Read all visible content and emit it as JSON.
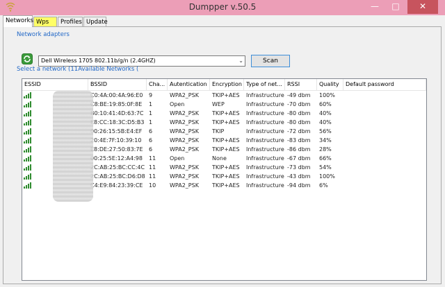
{
  "window": {
    "title": "Dumpper v.50.5"
  },
  "titlebar": {
    "min": "—",
    "max": "□",
    "close": "✕"
  },
  "tabs": [
    {
      "label": "Networks",
      "active": true,
      "highlight": false
    },
    {
      "label": "Wps",
      "active": false,
      "highlight": true
    },
    {
      "label": "Profiles",
      "active": false,
      "highlight": false
    },
    {
      "label": "Update",
      "active": false,
      "highlight": false
    }
  ],
  "adapters": {
    "label": "Network adapters",
    "selected": "Dell Wireless 1705 802.11b/g/n (2.4GHZ)",
    "scan_label": "Scan"
  },
  "networks": {
    "label": "Select a network (11Available Networks (",
    "columns": [
      "ESSID",
      "BSSID",
      "Cha...",
      "Autentication",
      "Encryption",
      "Type of net...",
      "RSSI",
      "Quality",
      "Default password"
    ],
    "rows": [
      [
        "",
        "C0:4A:00:4A:96:E0",
        "9",
        "WPA2_PSK",
        "TKIP+AES",
        "Infrastructure",
        "-49 dbm",
        "100%",
        ""
      ],
      [
        "",
        "C8:BE:19:85:0F:8E",
        "1",
        "Open",
        "WEP",
        "Infrastructure",
        "-70 dbm",
        "60%",
        ""
      ],
      [
        "",
        "B0:10:41:4D:63:7C",
        "1",
        "WPA2_PSK",
        "TKIP+AES",
        "Infrastructure",
        "-80 dbm",
        "40%",
        ""
      ],
      [
        "",
        "E8:CC:18:3C:D5:B3",
        "1",
        "WPA2_PSK",
        "TKIP+AES",
        "Infrastructure",
        "-80 dbm",
        "40%",
        ""
      ],
      [
        "",
        "00:26:15:5B:E4:EF",
        "6",
        "WPA2_PSK",
        "TKIP",
        "Infrastructure",
        "-72 dbm",
        "56%",
        ""
      ],
      [
        "",
        "20:4E:7F:10:39:10",
        "6",
        "WPA2_PSK",
        "TKIP+AES",
        "Infrastructure",
        "-83 dbm",
        "34%",
        ""
      ],
      [
        "",
        "E8:DE:27:50:83:7E",
        "6",
        "WPA2_PSK",
        "TKIP+AES",
        "Infrastructure",
        "-86 dbm",
        "28%",
        ""
      ],
      [
        "",
        "00:25:5E:12:A4:98",
        "11",
        "Open",
        "None",
        "Infrastructure",
        "-67 dbm",
        "66%",
        ""
      ],
      [
        "",
        "2C:AB:25:BC:CC:4C",
        "11",
        "WPA2_PSK",
        "TKIP+AES",
        "Infrastructure",
        "-73 dbm",
        "54%",
        ""
      ],
      [
        "",
        "2C:AB:25:BC:D6:D8",
        "11",
        "WPA2_PSK",
        "TKIP+AES",
        "Infrastructure",
        "-43 dbm",
        "100%",
        ""
      ],
      [
        "",
        "C4:E9:84:23:39:CE",
        "10",
        "WPA2_PSK",
        "TKIP+AES",
        "Infrastructure",
        "-94 dbm",
        "6%",
        ""
      ]
    ]
  },
  "colors": {
    "titlebar": "#ec9eb7",
    "accent": "#1f66c6",
    "highlight": "#ffff66",
    "signal": "#2e8b2e"
  }
}
